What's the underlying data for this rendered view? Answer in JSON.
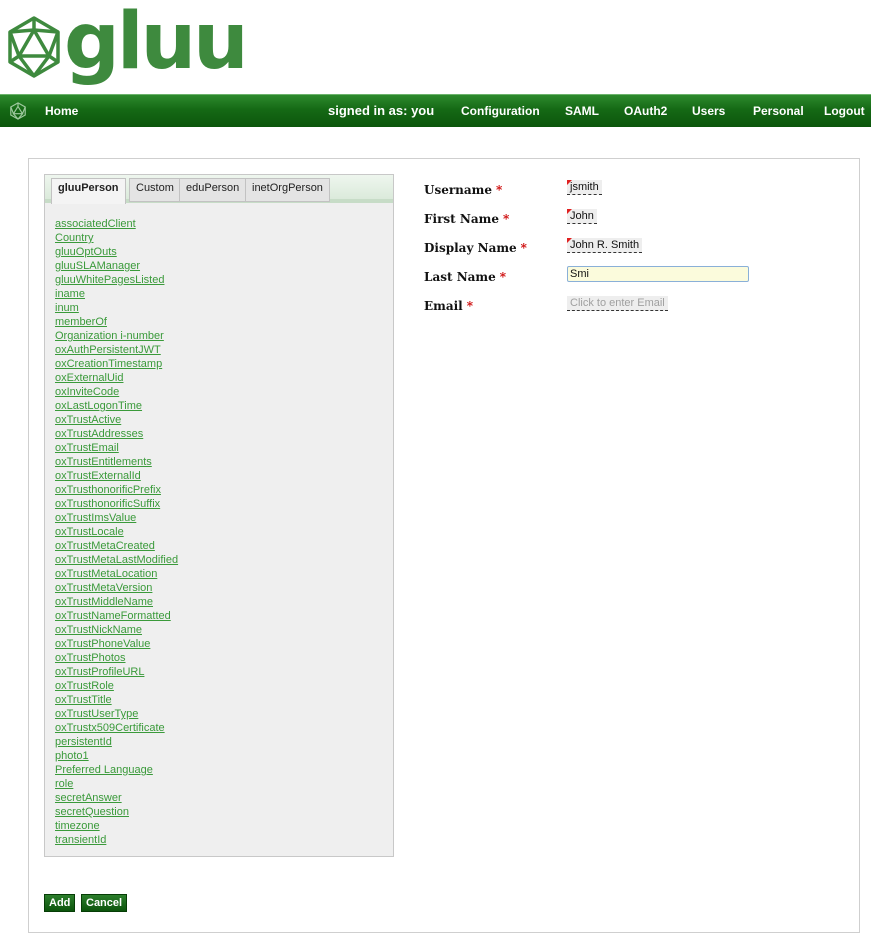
{
  "brand": {
    "name": "gluu"
  },
  "nav": {
    "home": "Home",
    "signed_in": "signed in as: you",
    "items": [
      "Configuration",
      "SAML",
      "OAuth2",
      "Users",
      "Personal",
      "Logout"
    ]
  },
  "tabs": [
    "gluuPerson",
    "Custom",
    "eduPerson",
    "inetOrgPerson"
  ],
  "attributes": [
    "associatedClient",
    "Country",
    "gluuOptOuts",
    "gluuSLAManager",
    "gluuWhitePagesListed",
    "iname",
    "inum",
    "memberOf",
    "Organization i-number",
    "oxAuthPersistentJWT",
    "oxCreationTimestamp",
    "oxExternalUid",
    "oxInviteCode",
    "oxLastLogonTime",
    "oxTrustActive",
    "oxTrustAddresses",
    "oxTrustEmail",
    "oxTrustEntitlements",
    "oxTrustExternalId",
    "oxTrusthonorificPrefix",
    "oxTrusthonorificSuffix",
    "oxTrustImsValue",
    "oxTrustLocale",
    "oxTrustMetaCreated",
    "oxTrustMetaLastModified",
    "oxTrustMetaLocation",
    "oxTrustMetaVersion",
    "oxTrustMiddleName",
    "oxTrustNameFormatted",
    "oxTrustNickName",
    "oxTrustPhoneValue",
    "oxTrustPhotos",
    "oxTrustProfileURL",
    "oxTrustRole",
    "oxTrustTitle",
    "oxTrustUserType",
    "oxTrustx509Certificate",
    "persistentId",
    "photo1",
    "Preferred Language",
    "role",
    "secretAnswer",
    "secretQuestion",
    "timezone",
    "transientId"
  ],
  "form": {
    "username": {
      "label": "Username",
      "required": "*",
      "value": "jsmith"
    },
    "first_name": {
      "label": "First Name",
      "required": "*",
      "value": "John"
    },
    "display_name": {
      "label": "Display Name",
      "required": "*",
      "value": "John R. Smith"
    },
    "last_name": {
      "label": "Last Name",
      "required": "*",
      "value": "Smi"
    },
    "email": {
      "label": "Email",
      "required": "*",
      "placeholder": "Click to enter Email"
    }
  },
  "buttons": {
    "add": "Add",
    "cancel": "Cancel"
  },
  "colors": {
    "nav_green": "#156915",
    "link_green": "#3a9a3a",
    "logo_green": "#3e8a3e",
    "required_red": "#cc0000"
  }
}
